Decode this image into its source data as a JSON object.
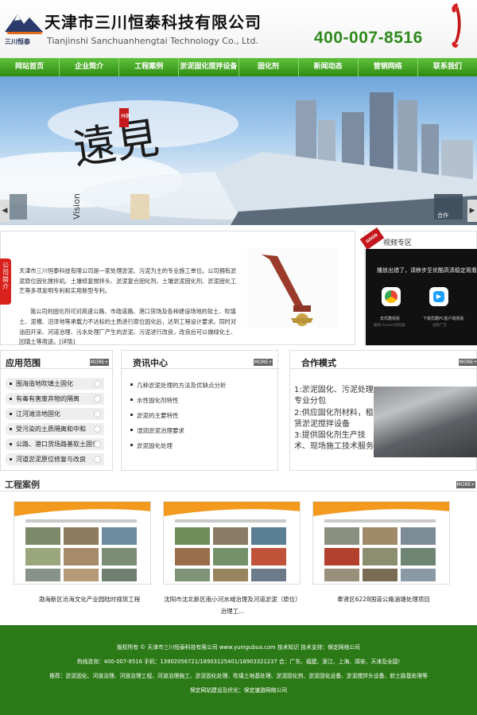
{
  "header": {
    "logo_short": "三川恒泰",
    "company_cn": "天津市三川恒泰科技有限公司",
    "company_en": "Tianjinshi Sanchuanhengtai Technology Co., Ltd.",
    "phone": "400-007-8516"
  },
  "nav": [
    "网站首页",
    "企业简介",
    "工程案例",
    "淤泥固化搅拌设备",
    "固化剂",
    "新闻动态",
    "营销网络",
    "联系我们"
  ],
  "banner": {
    "calligraphy": "遠見",
    "seal": "林鹏",
    "latin": "Vision",
    "thumb_caption": "合作"
  },
  "about": {
    "tag": "公司简介",
    "paragraph1": "天津市三川恒泰科技有限公司是一家处理淤泥、污泥为主的专业施工单位。公司拥有淤泥原位固化搅拌机、土壤修复搅拌头、淤泥复合固化剂、土壤淤泥固化剂、淤泥固化工艺等多项发明专利和实用新型专利。",
    "paragraph2": "我公司的固化剂可对高速公路、市政道路、港口货场及各种建设场地的软土、吹填土、泥槽、沼泽地等承载力不达标的土质进行原位固化后，达到工程设计要求。同时对油田开采、河道治理、污水处理厂产生的淤泥、污泥进行改良，改良后可以做绿化土、回填土等用途。[详情]"
  },
  "video": {
    "title": "视频专区",
    "message": "播放出错了，请移步至优酷高清稳定观看",
    "app1": "去优酷观看",
    "app1_sub": "推荐chrome浏览器",
    "app2": "下载优酷PC客户端观看",
    "app2_sub": "减免广告",
    "corner": "GOOD"
  },
  "application": {
    "title": "应用范围",
    "more": "MORE+",
    "items": [
      "围海造地吹填土固化",
      "有毒有害废弃物的隔离",
      "江河滩涂地固化",
      "受污染的土质隔离和中和",
      "公路、港口货场路基软土固化",
      "河道淤泥原位修复与改良"
    ]
  },
  "news": {
    "title": "资讯中心",
    "more": "MORE+",
    "items": [
      "几种淤泥处理的方法及优缺点分析",
      "水性固化剂特性",
      "淤泥的主要特性",
      "湿润淤泥治理要求",
      "淤泥固化处理"
    ]
  },
  "coop": {
    "title": "合作模式",
    "more": "MORE+",
    "text": "1:淤泥固化、污泥处理专业分包\n2:供应固化剂材料，租赁淤泥搅拌设备\n3:提供固化剂生产技术、现场施工技术服务"
  },
  "cases": {
    "title": "工程案例",
    "more": "MORE+",
    "items": [
      {
        "caption": "渤海新区沧海文化产业园陆时规现工程"
      },
      {
        "caption": "沈阳市沈北新区南小河水域治理及河道淤泥（原位）治理工..."
      },
      {
        "caption": "奉贤区6228国道公路涵塘处理项目"
      }
    ]
  },
  "footer": {
    "line1": "版权所有 © 天津市三川恒泰科技有限公司  www.yunigubua.com  技术知识  技术支持：保定网络公司",
    "line2": "热线咨询：400-007-8516  手机：13902056721/18903125401/18903321237  合：广东、福建、浙江、上海、靖安、天津及全国!",
    "line3": "推荐：淤泥固化、河道治理、河道治理工程、河道治理施工、淤泥固化处理、吹填土地基处理、淤泥固化剂、淤泥固化设备、淤泥搅拌头设备、软土路基处理等",
    "line4": "保定网站建设及优化：保定速游网络公司"
  },
  "colors": {
    "brand_green": "#2e8b12",
    "footer_green": "#2c7a17",
    "accent_red": "#d8201c",
    "phone_green": "#2f8a1c"
  }
}
